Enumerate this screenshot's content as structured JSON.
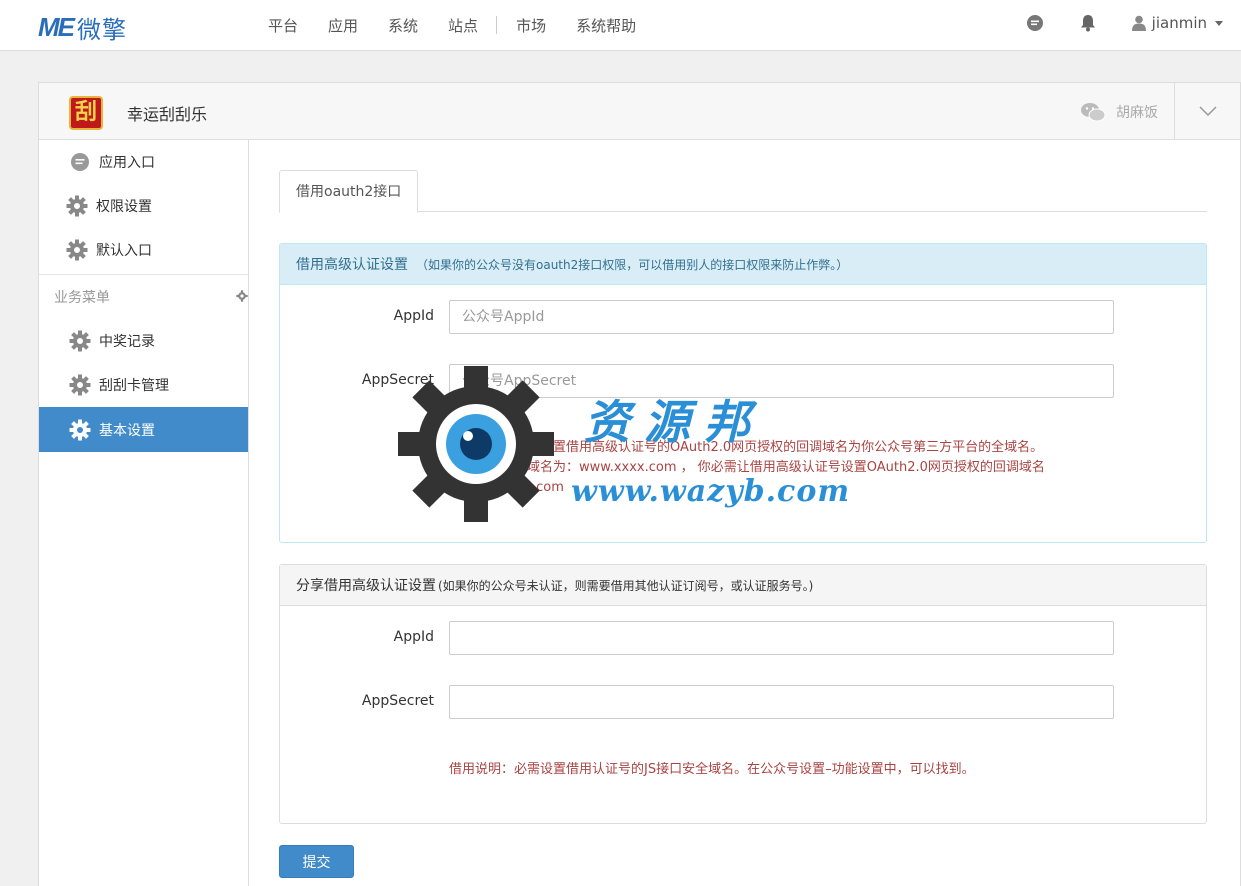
{
  "brand": {
    "logo_letters": "ME",
    "logo_text": "微擎"
  },
  "nav": {
    "items": [
      "平台",
      "应用",
      "系统",
      "站点",
      "市场",
      "系统帮助"
    ]
  },
  "user": {
    "name": "jianmin"
  },
  "app": {
    "icon_text": "刮",
    "name": "幸运刮刮乐",
    "account": "胡麻饭"
  },
  "sidebar": {
    "items": [
      {
        "label": "应用入口",
        "icon": "chat-bubble-icon"
      },
      {
        "label": "权限设置",
        "icon": "gear-icon"
      },
      {
        "label": "默认入口",
        "icon": "gear-icon"
      }
    ],
    "group_label": "业务菜单",
    "biz_items": [
      {
        "label": "中奖记录",
        "icon": "gear-icon"
      },
      {
        "label": "刮刮卡管理",
        "icon": "gear-icon"
      },
      {
        "label": "基本设置",
        "icon": "gear-icon",
        "active": true
      }
    ]
  },
  "tabs": [
    "借用oauth2接口"
  ],
  "section1": {
    "title": "借用高级认证设置",
    "note": "（如果你的公众号没有oauth2接口权限，可以借用别人的接口权限来防止作弊。）",
    "appid_label": "AppId",
    "appid_placeholder": "公众号AppId",
    "appsecret_label": "AppSecret",
    "appsecret_placeholder": "公众号AppSecret",
    "help_line1": "借用说明：必需设置借用高级认证号的OAuth2.0网页授权的回调域名为你公众号第三方平台的全域名。",
    "help_line2": "如：你的系统域名为：www.xxxx.com ， 你必需让借用高级认证号设置OAuth2.0网页授权的回调域名为:www.xxxx.com"
  },
  "section2": {
    "title": "分享借用高级认证设置",
    "note": "(如果你的公众号未认证，则需要借用其他认证订阅号，或认证服务号。)",
    "appid_label": "AppId",
    "appid_value": "",
    "appsecret_label": "AppSecret",
    "appsecret_value": "",
    "help": "借用说明：必需设置借用认证号的JS接口安全域名。在公众号设置–功能设置中，可以找到。"
  },
  "submit_label": "提交",
  "watermark": {
    "title": "资源邦",
    "url": "www.wazyb.com"
  },
  "colors": {
    "primary": "#428bca",
    "info_bg": "#d9edf7",
    "help_text": "#a94442",
    "brand": "#2a6ebb"
  }
}
